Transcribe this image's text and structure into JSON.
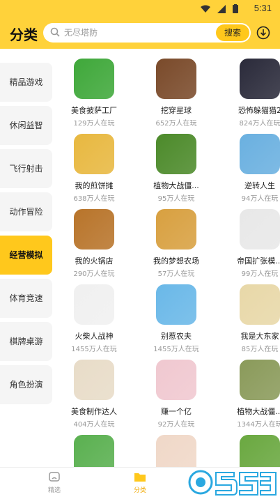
{
  "statusbar": {
    "time": "5:31"
  },
  "header": {
    "title": "分类",
    "search_placeholder": "无尽塔防",
    "search_button": "搜索"
  },
  "sidebar": {
    "items": [
      {
        "label": "精品游戏",
        "active": false
      },
      {
        "label": "休闲益智",
        "active": false
      },
      {
        "label": "飞行射击",
        "active": false
      },
      {
        "label": "动作冒险",
        "active": false
      },
      {
        "label": "经营模拟",
        "active": true
      },
      {
        "label": "体育竞速",
        "active": false
      },
      {
        "label": "棋牌桌游",
        "active": false
      },
      {
        "label": "角色扮演",
        "active": false
      }
    ]
  },
  "games": [
    {
      "name": "美食披萨工厂",
      "plays": "129万人在玩",
      "color": "#3fa83a"
    },
    {
      "name": "挖穿星球",
      "plays": "652万人在玩",
      "color": "#7a4a2a"
    },
    {
      "name": "恐怖躲猫猫2",
      "plays": "824万人在玩",
      "color": "#2a2a3a"
    },
    {
      "name": "我的煎饼摊",
      "plays": "638万人在玩",
      "color": "#e8b840"
    },
    {
      "name": "植物大战僵...",
      "plays": "95万人在玩",
      "color": "#4c8a2a"
    },
    {
      "name": "逆转人生",
      "plays": "94万人在玩",
      "color": "#6ab0e0"
    },
    {
      "name": "我的火锅店",
      "plays": "290万人在玩",
      "color": "#b8742a"
    },
    {
      "name": "我的梦想农场",
      "plays": "57万人在玩",
      "color": "#d8a040"
    },
    {
      "name": "帝国扩张模...",
      "plays": "99万人在玩",
      "color": "#e8e8e8"
    },
    {
      "name": "火柴人战神",
      "plays": "1455万人在玩",
      "color": "#f0f0f0"
    },
    {
      "name": "别惹农夫",
      "plays": "1455万人在玩",
      "color": "#6ab8e8"
    },
    {
      "name": "我是大东家",
      "plays": "85万人在玩",
      "color": "#e8d8a8"
    },
    {
      "name": "美食制作达人",
      "plays": "404万人在玩",
      "color": "#e8dcc8"
    },
    {
      "name": "赚一个亿",
      "plays": "92万人在玩",
      "color": "#f0c8d0"
    },
    {
      "name": "植物大战僵...",
      "plays": "1344万人在玩",
      "color": "#8a9a5a"
    },
    {
      "name": "",
      "plays": "",
      "color": "#5ab050"
    },
    {
      "name": "",
      "plays": "",
      "color": "#f0d8c8"
    },
    {
      "name": "",
      "plays": "",
      "color": "#6aa840"
    }
  ],
  "bottomnav": {
    "items": [
      {
        "label": "精选",
        "active": false
      },
      {
        "label": "分类",
        "active": true
      }
    ]
  },
  "colors": {
    "accent": "#ffd23a",
    "button": "#ffc81c",
    "active_text": "#f0a800"
  }
}
